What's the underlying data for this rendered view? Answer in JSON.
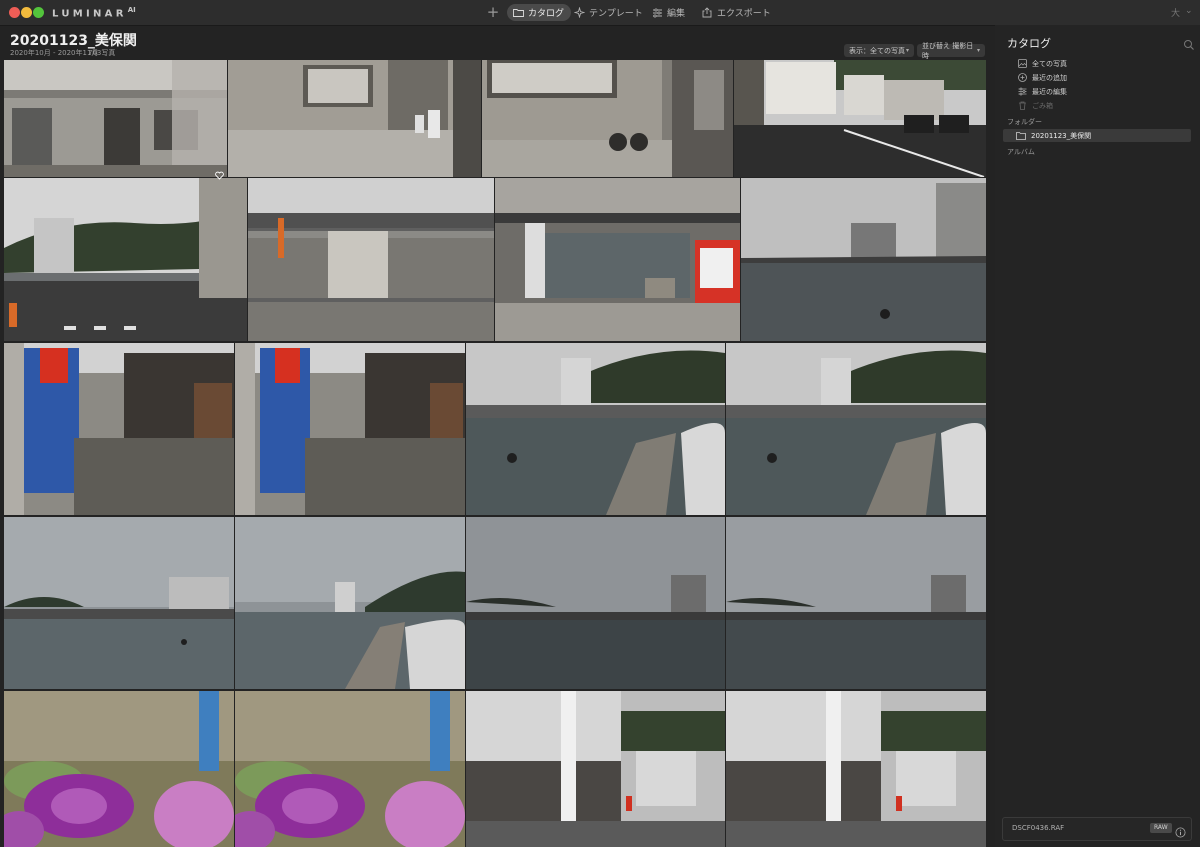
{
  "app": {
    "logo": "LUMINAR",
    "logo_version": "AI"
  },
  "toolbar": {
    "add_label": "+",
    "tabs": [
      {
        "label": "カタログ",
        "icon": "folder-icon",
        "active": true
      },
      {
        "label": "テンプレート",
        "icon": "sparkle-icon",
        "active": false
      },
      {
        "label": "編集",
        "icon": "sliders-icon",
        "active": false
      },
      {
        "label": "エクスポート",
        "icon": "share-icon",
        "active": false
      }
    ],
    "right_a": "大",
    "right_b": "⌄"
  },
  "header": {
    "title": "20201123_美保関",
    "date_range": "2020年10月 - 2020年11月",
    "photo_count": "763写真",
    "show_filter": "表示：全ての写真",
    "sort": "並び替え 撮影日時"
  },
  "panel": {
    "title": "カタログ",
    "items": [
      {
        "label": "全ての写真",
        "icon": "photos-icon"
      },
      {
        "label": "最近の追加",
        "icon": "plus-circle-icon"
      },
      {
        "label": "最近の編集",
        "icon": "sliders-icon"
      },
      {
        "label": "ごみ箱",
        "icon": "trash-icon"
      }
    ],
    "folders_label": "フォルダー",
    "folder": "20201123_美保関",
    "albums_label": "アルバム"
  },
  "footer": {
    "file_name": "DSCF0436.RAF",
    "badge": "RAW"
  },
  "photos": [
    "building-facade",
    "wall-gas-cylinders",
    "shop-hand-truck",
    "street-houses",
    "harbor-street-wide",
    "no-entry-sign",
    "storefront-vending",
    "harbor-waterfront",
    "narrow-alley-banner",
    "narrow-alley-banner-2",
    "harbor-pier-car",
    "harbor-pier-car-2",
    "harbor-cloudy-sky",
    "harbor-cloudy-sky-2",
    "harbor-dark-sky",
    "harbor-dark-sky-2",
    "ornamental-kale",
    "ornamental-kale-2",
    "ryokan-street",
    "ryokan-street-2"
  ],
  "colors": {
    "background": "#232323",
    "accent": "#3a3a3a"
  }
}
